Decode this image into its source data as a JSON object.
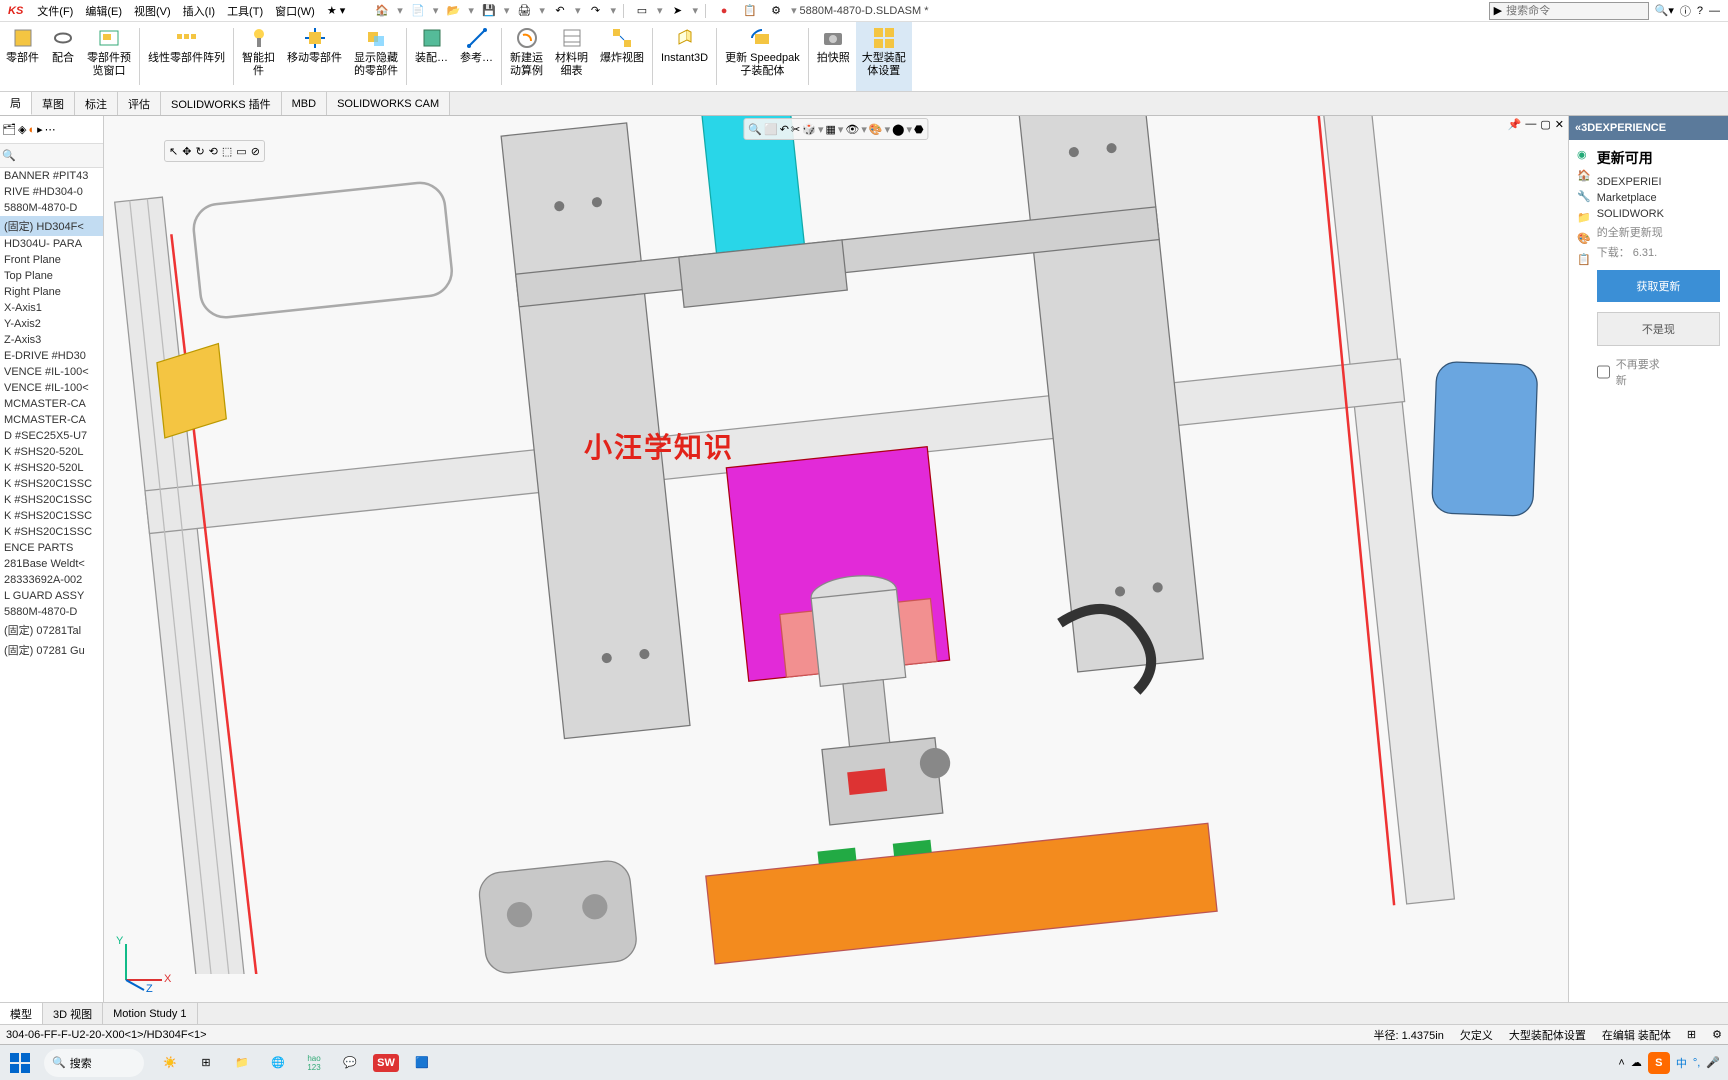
{
  "app": {
    "logo": "KS",
    "title": "5880M-4870-D.SLDASM *"
  },
  "menus": [
    "文件(F)",
    "编辑(E)",
    "视图(V)",
    "插入(I)",
    "工具(T)",
    "窗口(W)"
  ],
  "search": {
    "placeholder": "搜索命令"
  },
  "ribbon": [
    {
      "id": "insert-comp",
      "label": "零部件"
    },
    {
      "id": "mate",
      "label": "配合"
    },
    {
      "id": "preview",
      "label": "零部件预\n览窗口"
    },
    {
      "id": "pattern",
      "label": "线性零部件阵列"
    },
    {
      "id": "smart-fastener",
      "label": "智能扣\n件"
    },
    {
      "id": "move-comp",
      "label": "移动零部件"
    },
    {
      "id": "show-hide",
      "label": "显示隐藏\n的零部件"
    },
    {
      "id": "assembly-feat",
      "label": "装配…"
    },
    {
      "id": "reference",
      "label": "参考…"
    },
    {
      "id": "motion-study",
      "label": "新建运\n动算例"
    },
    {
      "id": "bom",
      "label": "材料明\n细表"
    },
    {
      "id": "exploded",
      "label": "爆炸视图"
    },
    {
      "id": "instant3d",
      "label": "Instant3D"
    },
    {
      "id": "speedpak",
      "label": "更新 Speedpak\n子装配体"
    },
    {
      "id": "snapshot",
      "label": "拍快照"
    },
    {
      "id": "large-assy",
      "label": "大型装配\n体设置",
      "active": true
    }
  ],
  "tabs": [
    "局",
    "草图",
    "标注",
    "评估",
    "SOLIDWORKS 插件",
    "MBD",
    "SOLIDWORKS CAM"
  ],
  "featureTree": [
    "BANNER #PIT43",
    "RIVE #HD304-0",
    "5880M-4870-D",
    "(固定) HD304F<",
    "HD304U- PARA",
    "Front Plane",
    "Top Plane",
    "Right Plane",
    "X-Axis1",
    "Y-Axis2",
    "Z-Axis3",
    "E-DRIVE #HD30",
    "VENCE #IL-100<",
    "VENCE #IL-100<",
    "MCMASTER-CA",
    "MCMASTER-CA",
    "D #SEC25X5-U7",
    "K #SHS20-520L",
    "K #SHS20-520L",
    "K #SHS20C1SSC",
    "K #SHS20C1SSC",
    "K #SHS20C1SSC",
    "K #SHS20C1SSC",
    "ENCE PARTS",
    "281Base Weldt<",
    "28333692A-002",
    "L GUARD ASSY",
    "5880M-4870-D",
    "(固定) 07281Tal",
    "(固定) 07281 Gu"
  ],
  "featureTreeSelectedIndex": 3,
  "watermark": "小汪学知识",
  "sidePanel": {
    "header": "«3DEXPERIENCE",
    "title": "更新可用",
    "lines": [
      "3DEXPERIEI",
      "Marketplace",
      "SOLIDWORK"
    ],
    "gray1": "的全新更新现",
    "download": "下载：  6.31.",
    "btnPrimary": "获取更新",
    "btnSecondary": "不是现",
    "checkLabel": "不再要求\n新"
  },
  "bottomTabs": [
    "模型",
    "3D 视图",
    "Motion Study 1"
  ],
  "status": {
    "left": "304-06-FF-F-U2-20-X00<1>/HD304F<1>",
    "radius": "半径: 1.4375in",
    "def": "欠定义",
    "assy": "大型装配体设置",
    "mode": "在编辑 装配体"
  },
  "taskbar": {
    "search": "搜索",
    "ime": "中"
  }
}
